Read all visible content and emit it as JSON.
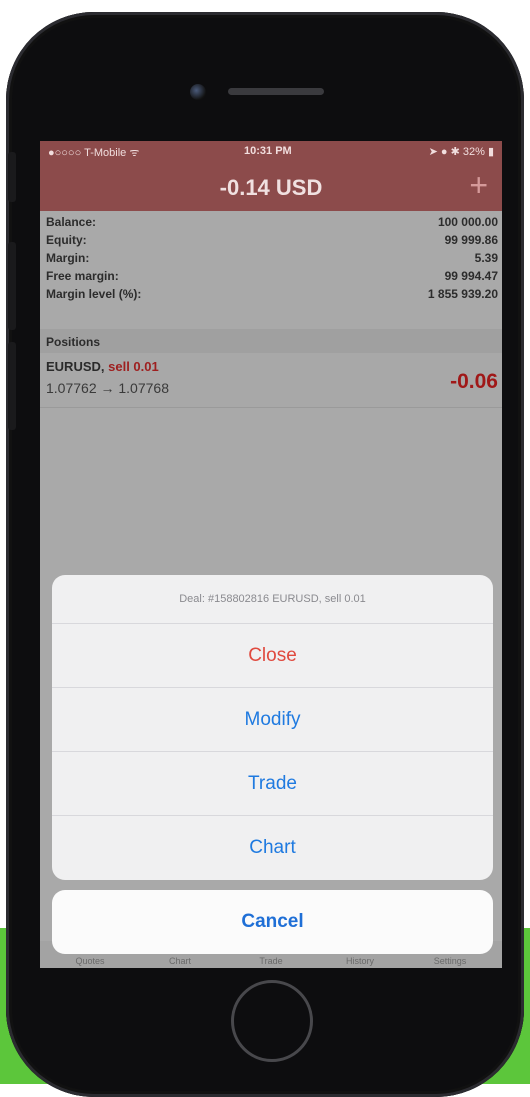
{
  "status_bar": {
    "carrier": "●○○○○ T-Mobile ᯤ",
    "time": "10:31 PM",
    "right": "➤ ● ✱ 32% ▮"
  },
  "header": {
    "title": "-0.14 USD",
    "add_label": "+"
  },
  "account": [
    {
      "label": "Balance:",
      "value": "100 000.00"
    },
    {
      "label": "Equity:",
      "value": "99 999.86"
    },
    {
      "label": "Margin:",
      "value": "5.39"
    },
    {
      "label": "Free margin:",
      "value": "99 994.47"
    },
    {
      "label": "Margin level (%):",
      "value": "1 855 939.20"
    }
  ],
  "positions": {
    "header": "Positions",
    "items": [
      {
        "symbol": "EURUSD,",
        "direction": "sell 0.01",
        "prices": "1.07762 → 1.07768",
        "profit": "-0.06"
      }
    ]
  },
  "action_sheet": {
    "title": "Deal: #158802816 EURUSD, sell 0.01",
    "items": [
      "Close",
      "Modify",
      "Trade",
      "Chart"
    ],
    "cancel": "Cancel"
  },
  "tab_bar": [
    "Quotes",
    "Chart",
    "Trade",
    "History",
    "Settings"
  ],
  "colors": {
    "header": "#8c4b4b",
    "loss": "#a01818",
    "ios_blue": "#1f7ae0",
    "destructive": "#e04a3f",
    "accent_bg": "#5cc63b"
  },
  "icons": [
    "camera-icon",
    "speaker-icon",
    "plus-icon",
    "home-button"
  ]
}
